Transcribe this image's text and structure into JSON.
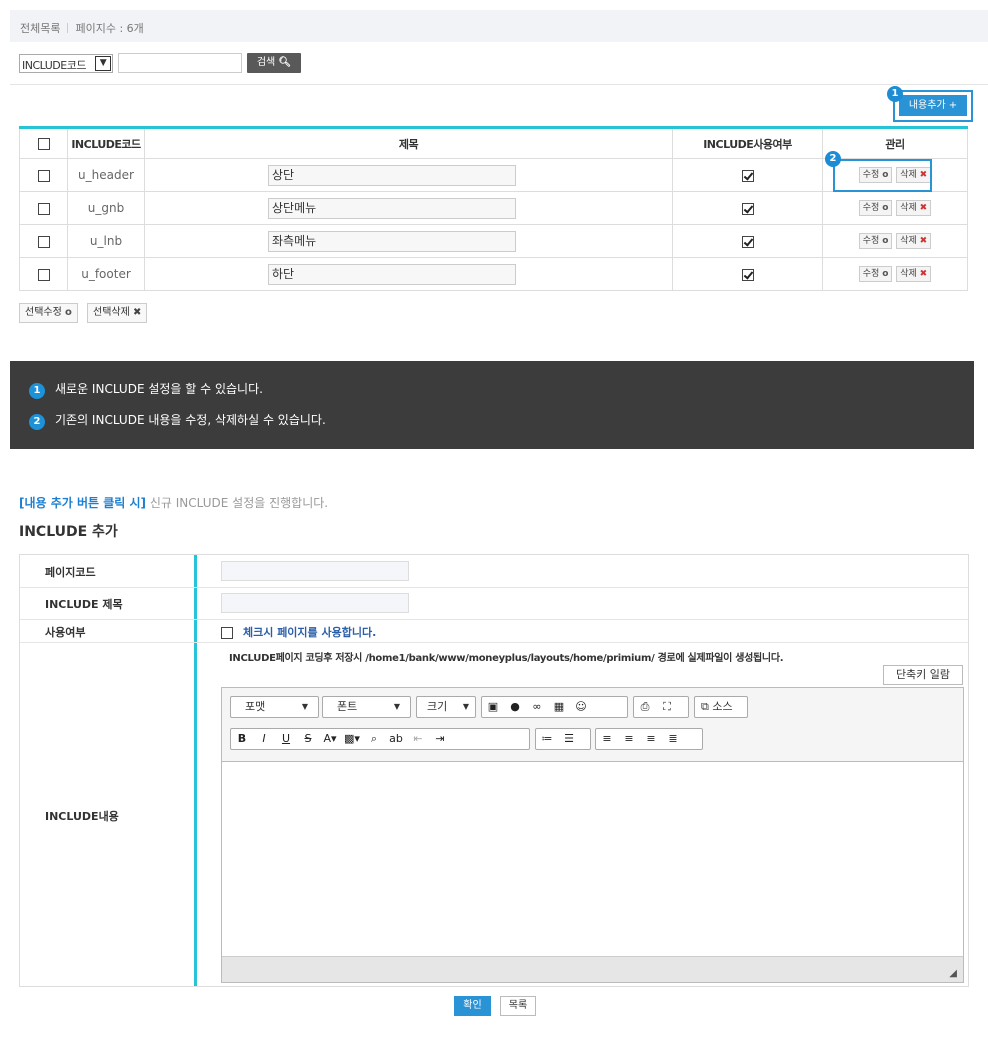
{
  "topbar": {
    "title": "전체목록",
    "count_label": "페이지수 : 6개"
  },
  "filter": {
    "select_value": "INCLUDE코드",
    "search_label": "검색"
  },
  "add_button_label": "내용추가 +",
  "badges": {
    "one": "1",
    "two": "2"
  },
  "table": {
    "headers": {
      "code": "INCLUDE코드",
      "title": "제목",
      "use": "INCLUDE사용여부",
      "manage": "관리"
    },
    "rows": [
      {
        "code": "u_header",
        "title": "상단"
      },
      {
        "code": "u_gnb",
        "title": "상단메뉴"
      },
      {
        "code": "u_lnb",
        "title": "좌측메뉴"
      },
      {
        "code": "u_footer",
        "title": "하단"
      }
    ],
    "edit_label": "수정",
    "delete_label": "삭제"
  },
  "bulk": {
    "edit_label": "선택수정",
    "delete_label": "선택삭제"
  },
  "info": {
    "line1": "새로운 INCLUDE 설정을 할 수 있습니다.",
    "line2": "기존의 INCLUDE 내용을 수정, 삭제하실 수 있습니다."
  },
  "caption": {
    "highlight": "[내용 추가 버튼 클릭 시]",
    "text": "신규 INCLUDE 설정을 진행합니다."
  },
  "section_title": "INCLUDE 추가",
  "form": {
    "page_code_label": "페이지코드",
    "title_label": "INCLUDE 제목",
    "use_label": "사용여부",
    "use_checkbox_text": "체크시 페이지를 사용합니다.",
    "content_label": "INCLUDE내용",
    "note": "INCLUDE페이지 코딩후 저장시 /home1/bank/www/moneyplus/layouts/home/primium/ 경로에 실제파일이 생성됩니다.",
    "shortcut_button": "단축키 일람"
  },
  "editor": {
    "format": "포맷",
    "font": "폰트",
    "size": "크기",
    "source": "소스",
    "bold": "B",
    "italic": "I",
    "underline": "U",
    "strike": "S"
  },
  "actions": {
    "confirm": "확인",
    "list": "목록"
  }
}
